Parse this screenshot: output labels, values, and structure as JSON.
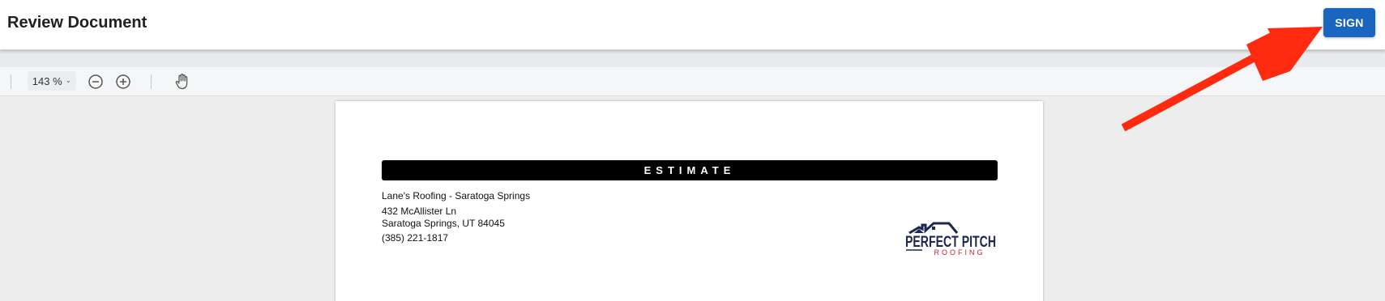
{
  "header": {
    "title": "Review Document",
    "sign_label": "SIGN"
  },
  "toolbar": {
    "zoom_value": "143 %",
    "icons": [
      "chevron-down-icon",
      "zoom-out-icon",
      "zoom-in-icon",
      "pan-hand-icon"
    ]
  },
  "document": {
    "heading": "ESTIMATE",
    "company": {
      "name": "Lane's Roofing - Saratoga Springs",
      "street": "432 McAllister Ln",
      "city_state_zip": "Saratoga Springs, UT 84045",
      "phone": "(385) 221-1817"
    },
    "logo": {
      "line1": "PERFECT PITCH",
      "line2": "ROOFING"
    }
  },
  "annotation": {
    "arrow_color": "#ff2a0f"
  },
  "colors": {
    "primary_button": "#1a65bf",
    "logo_navy": "#1c2752",
    "logo_red": "#c8202b"
  }
}
